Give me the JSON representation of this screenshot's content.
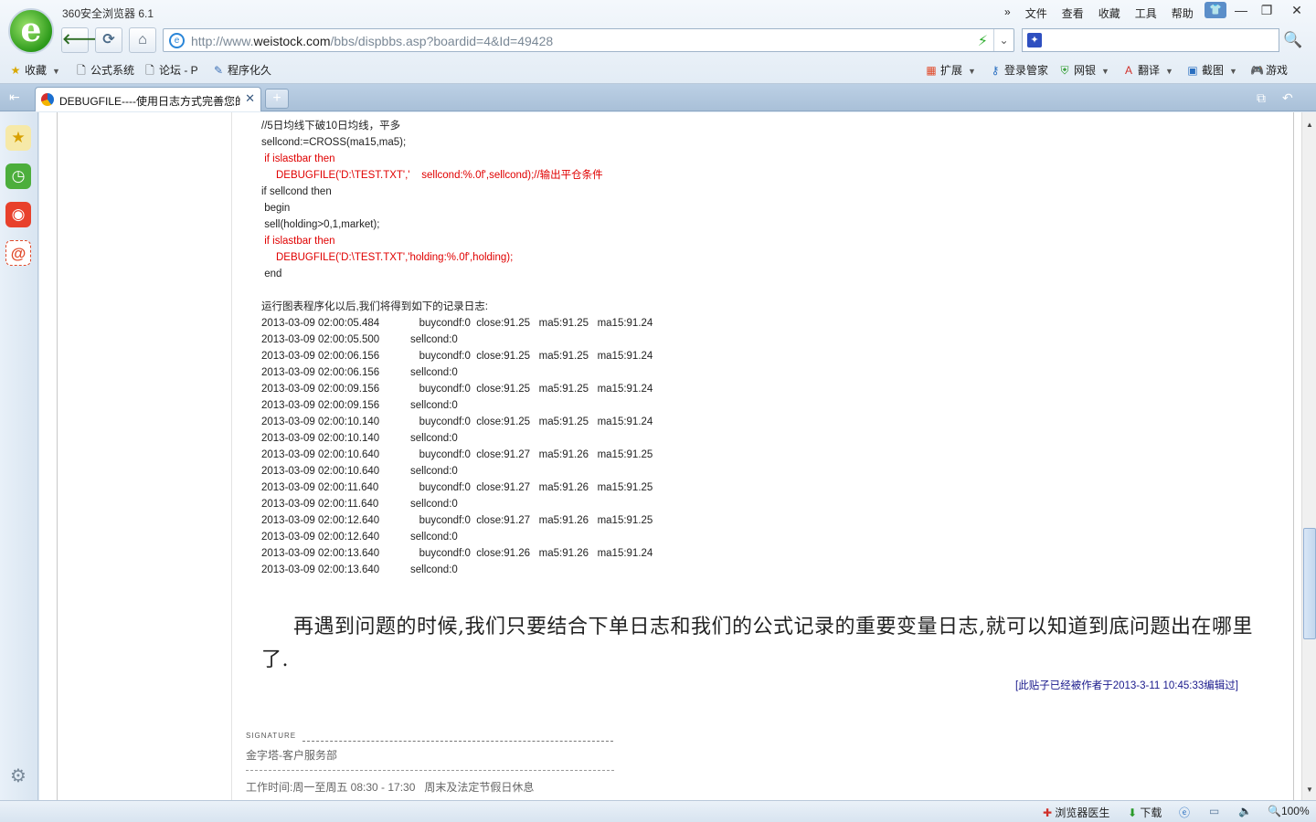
{
  "app": {
    "title": "360安全浏览器 6.1",
    "menu": [
      "文件",
      "查看",
      "收藏",
      "工具",
      "帮助"
    ]
  },
  "nav": {
    "url_prefix": "http://www.",
    "url_domain": "weistock.com",
    "url_path": "/bbs/dispbbs.asp?boardid=4&Id=49428"
  },
  "favorites": {
    "left": [
      {
        "label": "收藏",
        "icon": "star-add-icon"
      },
      {
        "label": "公式系统",
        "icon": "page-icon"
      },
      {
        "label": "论坛 - P",
        "icon": "page-icon"
      },
      {
        "label": "程序化久",
        "icon": "tool-icon"
      }
    ],
    "right": [
      {
        "label": "扩展",
        "icon": "extension-icon"
      },
      {
        "label": "登录管家",
        "icon": "key-icon"
      },
      {
        "label": "网银",
        "icon": "shield-icon"
      },
      {
        "label": "翻译",
        "icon": "translate-icon"
      },
      {
        "label": "截图",
        "icon": "screenshot-icon"
      },
      {
        "label": "游戏",
        "icon": "game-icon"
      }
    ]
  },
  "tab": {
    "title": "DEBUGFILE----使用日志方式完善您的"
  },
  "code_lines": [
    {
      "text": "//5日均线下破10日均线，平多",
      "red": false
    },
    {
      "text": "sellcond:=CROSS(ma15,ma5);",
      "red": false
    },
    {
      "text": " if islastbar then",
      "red": true
    },
    {
      "text": "     DEBUGFILE('D:\\TEST.TXT','    sellcond:%.0f',sellcond);//输出平仓条件",
      "red": true
    },
    {
      "text": "if sellcond then",
      "red": false
    },
    {
      "text": " begin",
      "red": false
    },
    {
      "text": " sell(holding>0,1,market);",
      "red": false
    },
    {
      "text": " if islastbar then",
      "red": true
    },
    {
      "text": "     DEBUGFILE('D:\\TEST.TXT','holding:%.0f',holding);",
      "red": true
    },
    {
      "text": " end",
      "red": false
    }
  ],
  "log_intro": "运行图表程序化以后,我们将得到如下的记录日志:",
  "log_rows": [
    {
      "ts": "2013-03-09 02:00:05.484",
      "msg": "   buycondf:0  close:91.25   ma5:91.25   ma15:91.24"
    },
    {
      "ts": "2013-03-09 02:00:05.500",
      "msg": "sellcond:0"
    },
    {
      "ts": "2013-03-09 02:00:06.156",
      "msg": "   buycondf:0  close:91.25   ma5:91.25   ma15:91.24"
    },
    {
      "ts": "2013-03-09 02:00:06.156",
      "msg": "sellcond:0"
    },
    {
      "ts": "2013-03-09 02:00:09.156",
      "msg": "   buycondf:0  close:91.25   ma5:91.25   ma15:91.24"
    },
    {
      "ts": "2013-03-09 02:00:09.156",
      "msg": "sellcond:0"
    },
    {
      "ts": "2013-03-09 02:00:10.140",
      "msg": "   buycondf:0  close:91.25   ma5:91.25   ma15:91.24"
    },
    {
      "ts": "2013-03-09 02:00:10.140",
      "msg": "sellcond:0"
    },
    {
      "ts": "2013-03-09 02:00:10.640",
      "msg": "   buycondf:0  close:91.27   ma5:91.26   ma15:91.25"
    },
    {
      "ts": "2013-03-09 02:00:10.640",
      "msg": "sellcond:0"
    },
    {
      "ts": "2013-03-09 02:00:11.640",
      "msg": "   buycondf:0  close:91.27   ma5:91.26   ma15:91.25"
    },
    {
      "ts": "2013-03-09 02:00:11.640",
      "msg": "sellcond:0"
    },
    {
      "ts": "2013-03-09 02:00:12.640",
      "msg": "   buycondf:0  close:91.27   ma5:91.26   ma15:91.25"
    },
    {
      "ts": "2013-03-09 02:00:12.640",
      "msg": "sellcond:0"
    },
    {
      "ts": "2013-03-09 02:00:13.640",
      "msg": "   buycondf:0  close:91.26   ma5:91.26   ma15:91.24"
    },
    {
      "ts": "2013-03-09 02:00:13.640",
      "msg": "sellcond:0"
    }
  ],
  "conclusion": "再遇到问题的时候,我们只要结合下单日志和我们的公式记录的重要变量日志,就可以知道到底问题出在哪里了.",
  "edited_note": "[此贴子已经被作者于2013-3-11 10:45:33编辑过]",
  "signature": {
    "heading": "SIGNATURE",
    "name": "金字塔-客户服务部",
    "hours": "工作时间:周一至周五 08:30 - 17:30   周末及法定节假日休息"
  },
  "status": {
    "doctor": "浏览器医生",
    "download": "下载",
    "zoom": "100%"
  }
}
